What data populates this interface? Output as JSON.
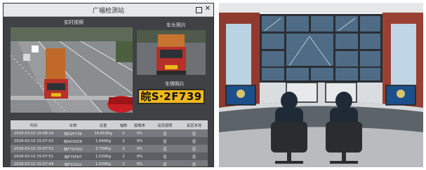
{
  "app": {
    "title": "广福检测站",
    "live_label": "实时视频",
    "side_label": "车头照片",
    "plate_label": "车牌照片",
    "plate_number": "皖S·2F739"
  },
  "records": {
    "headers": [
      "时间",
      "车牌",
      "总重",
      "轴数",
      "超载率",
      "是否超限",
      "是否本地"
    ],
    "rows": [
      [
        "2018-03-10 15:08:14",
        "皖S2F739",
        "14,610Kg",
        "2",
        "0%",
        "否",
        "否"
      ],
      [
        "2018-03-10 15:07:53",
        "皖A030Z8",
        "1,640Kg",
        "2",
        "0%",
        "否",
        "否"
      ],
      [
        "2018-03-10 15:07:51",
        "皖F797DU",
        "2,730Kg",
        "2",
        "0%",
        "否",
        "否"
      ],
      [
        "2018-03-10 15:07:51",
        "皖F75F67",
        "1,530Kg",
        "2",
        "0%",
        "否",
        "否"
      ],
      [
        "2018-03-10 15:07:49",
        "皖F102LV",
        "1,030Kg",
        "2",
        "0%",
        "否",
        "否"
      ]
    ]
  },
  "colors": {
    "plate_yellow": "#f0b81b",
    "panel_dark": "#3f4144"
  },
  "icons": [
    "restore-icon",
    "close-icon"
  ]
}
